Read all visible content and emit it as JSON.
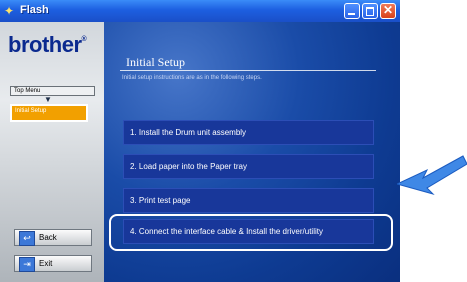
{
  "window": {
    "title": "Flash"
  },
  "sidebar": {
    "logo": "brother",
    "logo_mark": "®",
    "nav_top": "Top Menu",
    "nav_current": "Initial Setup",
    "back_label": "Back",
    "exit_label": "Exit"
  },
  "main": {
    "heading": "Initial Setup",
    "subtitle": "Initial setup instructions are as in the following steps.",
    "steps": [
      {
        "label": "1. Install the Drum unit assembly"
      },
      {
        "label": "2. Load paper into the Paper tray"
      },
      {
        "label": "3. Print test page"
      },
      {
        "label": "4. Connect the interface cable & Install the driver/utility"
      }
    ]
  },
  "colors": {
    "title_bar": "#1d5fe0",
    "main_bg": "#0e3b92",
    "step_bg": "#18379a",
    "active_nav": "#f2a000",
    "arrow": "#3f88e6"
  }
}
